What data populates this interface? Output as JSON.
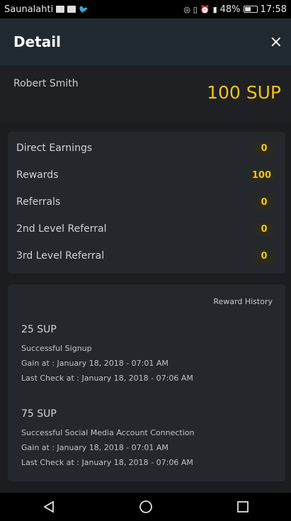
{
  "status_bar": {
    "carrier": "Saunalahti",
    "battery": "48%",
    "time": "17:58"
  },
  "header": {
    "title": "Detail",
    "close_label": "×"
  },
  "summary": {
    "name": "Robert Smith",
    "total": "100 SUP"
  },
  "earnings": [
    {
      "label": "Direct Earnings",
      "value": "0"
    },
    {
      "label": "Rewards",
      "value": "100"
    },
    {
      "label": "Referrals",
      "value": "0"
    },
    {
      "label": "2nd Level Referral",
      "value": "0"
    },
    {
      "label": "3rd Level Referral",
      "value": "0"
    }
  ],
  "history": {
    "link_label": "Reward History",
    "entries": [
      {
        "amount": "25 SUP",
        "description": "Successful Signup",
        "gain": "Gain at : January 18, 2018 - 07:01 AM",
        "last_check": "Last Check at : January 18, 2018 - 07:06 AM"
      },
      {
        "amount": "75 SUP",
        "description": "Successful Social Media Account Connection",
        "gain": "Gain at : January 18, 2018 - 07:01 AM",
        "last_check": "Last Check at : January 18, 2018 - 07:06 AM"
      }
    ]
  },
  "colors": {
    "accent": "#f2c318",
    "background": "#1b1d21",
    "header": "#222a31",
    "card": "#24272c"
  }
}
